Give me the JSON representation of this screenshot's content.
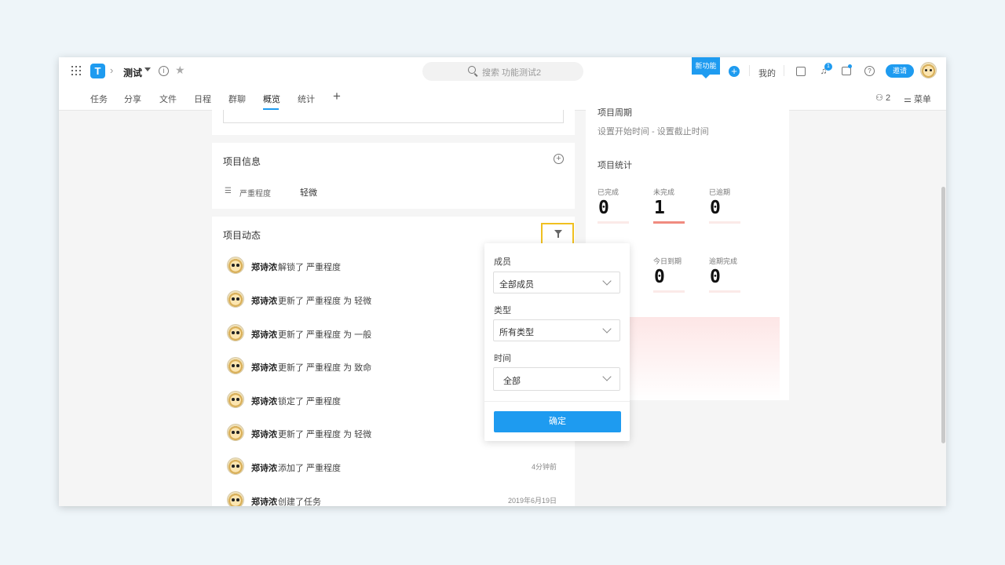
{
  "header": {
    "project_title": "测试",
    "search_placeholder": "搜索 功能测试2",
    "new_feature_badge": "新功能",
    "mine_label": "我的",
    "notification_count": "1",
    "invite_label": "邀请"
  },
  "tabs": [
    "任务",
    "分享",
    "文件",
    "日程",
    "群聊",
    "概览",
    "统计"
  ],
  "active_tab": "概览",
  "toolbar": {
    "members_count": "2",
    "menu_label": "菜单"
  },
  "project_info": {
    "title": "项目信息",
    "field_label": "严重程度",
    "field_value": "轻微"
  },
  "activity": {
    "title": "项目动态",
    "items": [
      {
        "user": "郑诗浓",
        "text": "解锁了 严重程度",
        "time": ""
      },
      {
        "user": "郑诗浓",
        "text": "更新了 严重程度 为 轻微",
        "time": ""
      },
      {
        "user": "郑诗浓",
        "text": "更新了 严重程度 为 一般",
        "time": ""
      },
      {
        "user": "郑诗浓",
        "text": "更新了 严重程度 为 致命",
        "time": ""
      },
      {
        "user": "郑诗浓",
        "text": "锁定了 严重程度",
        "time": ""
      },
      {
        "user": "郑诗浓",
        "text": "更新了 严重程度 为 轻微",
        "time": ""
      },
      {
        "user": "郑诗浓",
        "text": "添加了 严重程度",
        "time": "4分钟前"
      },
      {
        "user": "郑诗浓",
        "text": "创建了任务",
        "time": "2019年6月19日"
      }
    ]
  },
  "right_panel": {
    "period_heading": "项目周期",
    "period_dates": "设置开始时间  -  设置截止时间",
    "stats_heading": "项目统计",
    "stats": [
      {
        "label": "已完成",
        "value": "0"
      },
      {
        "label": "未完成",
        "value": "1"
      },
      {
        "label": "已逾期",
        "value": "0"
      },
      {
        "label": "今日到期",
        "value": "0"
      },
      {
        "label": "逾期完成",
        "value": "0"
      }
    ]
  },
  "filter_popover": {
    "member_label": "成员",
    "member_value": "全部成员",
    "type_label": "类型",
    "type_value": "所有类型",
    "time_label": "时间",
    "time_value": "全部",
    "confirm_label": "确定"
  },
  "colors": {
    "accent": "#1e9bf0",
    "highlight_border": "#f0c020",
    "stat_bar_active": "#f08b80"
  }
}
